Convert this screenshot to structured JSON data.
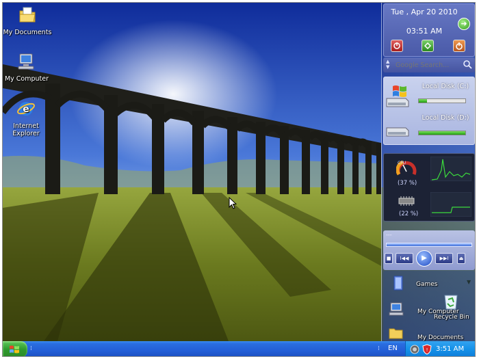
{
  "desktop": {
    "icons": [
      {
        "label": "My Documents"
      },
      {
        "label": "My Computer"
      },
      {
        "label": "Internet Explorer"
      }
    ]
  },
  "sidebar": {
    "clock": {
      "date": "Tue , Apr 20 2010",
      "time": "03:51 AM"
    },
    "search": {
      "placeholder": "Google Search..."
    },
    "drives": [
      {
        "label": "Local Disk (C:)",
        "usage": 0.18
      },
      {
        "label": "Local Disk (D:)",
        "usage": 1.0
      }
    ],
    "cpu": {
      "cpu_percent": "(37 %)",
      "ram_percent": "(22 %)",
      "cpu_badge": "CPU"
    },
    "media": {
      "title": "---",
      "buttons": {
        "stop": "■",
        "prev": "I◀◀",
        "play": "▶",
        "next": "▶▶I",
        "eject": "⏏"
      }
    },
    "launcher": {
      "games": "Games",
      "my_computer": "My Computer",
      "recycle_bin": "Recycle Bin",
      "my_documents": "My Documents"
    }
  },
  "taskbar": {
    "lang": "EN",
    "time": "3:51 AM"
  },
  "colors": {
    "sky_top": "#0f2c9a",
    "sky_bottom": "#b4d2f4",
    "grass": "#6b7a1f",
    "taskbar": "#235ed6",
    "start_green": "#2f9a2d",
    "tray_blue": "#1591e8"
  }
}
